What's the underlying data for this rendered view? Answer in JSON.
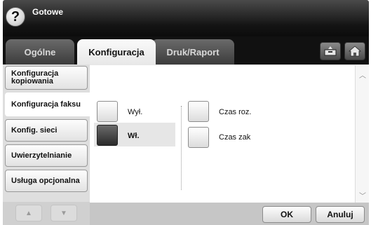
{
  "header": {
    "help_icon": "question-mark-icon",
    "help_glyph": "?",
    "status": "Gotowe"
  },
  "tabs": [
    {
      "label": "Ogólne",
      "active": false
    },
    {
      "label": "Konfiguracja",
      "active": true
    },
    {
      "label": "Druk/Raport",
      "active": false
    }
  ],
  "toolbar_icons": {
    "tray": "tray-icon",
    "home": "home-icon"
  },
  "nav": {
    "items": [
      {
        "label": "Konfiguracja kopiowania",
        "active": false
      },
      {
        "label": "Konfiguracja faksu",
        "active": true
      },
      {
        "label": "Konfig. sieci",
        "active": false
      },
      {
        "label": "Uwierzytelnianie",
        "active": false
      },
      {
        "label": "Usługa opcjonalna",
        "active": false
      }
    ],
    "up_glyph": "▲",
    "down_glyph": "▼"
  },
  "options": {
    "off_label": "Wył.",
    "on_label": "Wł.",
    "selected": "Wł.",
    "dst_start_label": "Czas roz.",
    "dst_end_label": "Czas zak"
  },
  "scroll": {
    "up_glyph": "︿",
    "down_glyph": "﹀"
  },
  "footer": {
    "ok_label": "OK",
    "cancel_label": "Anuluj"
  },
  "colors": {
    "header": "#141414",
    "active_option": "#2a2a2a",
    "panel": "#dedede"
  }
}
